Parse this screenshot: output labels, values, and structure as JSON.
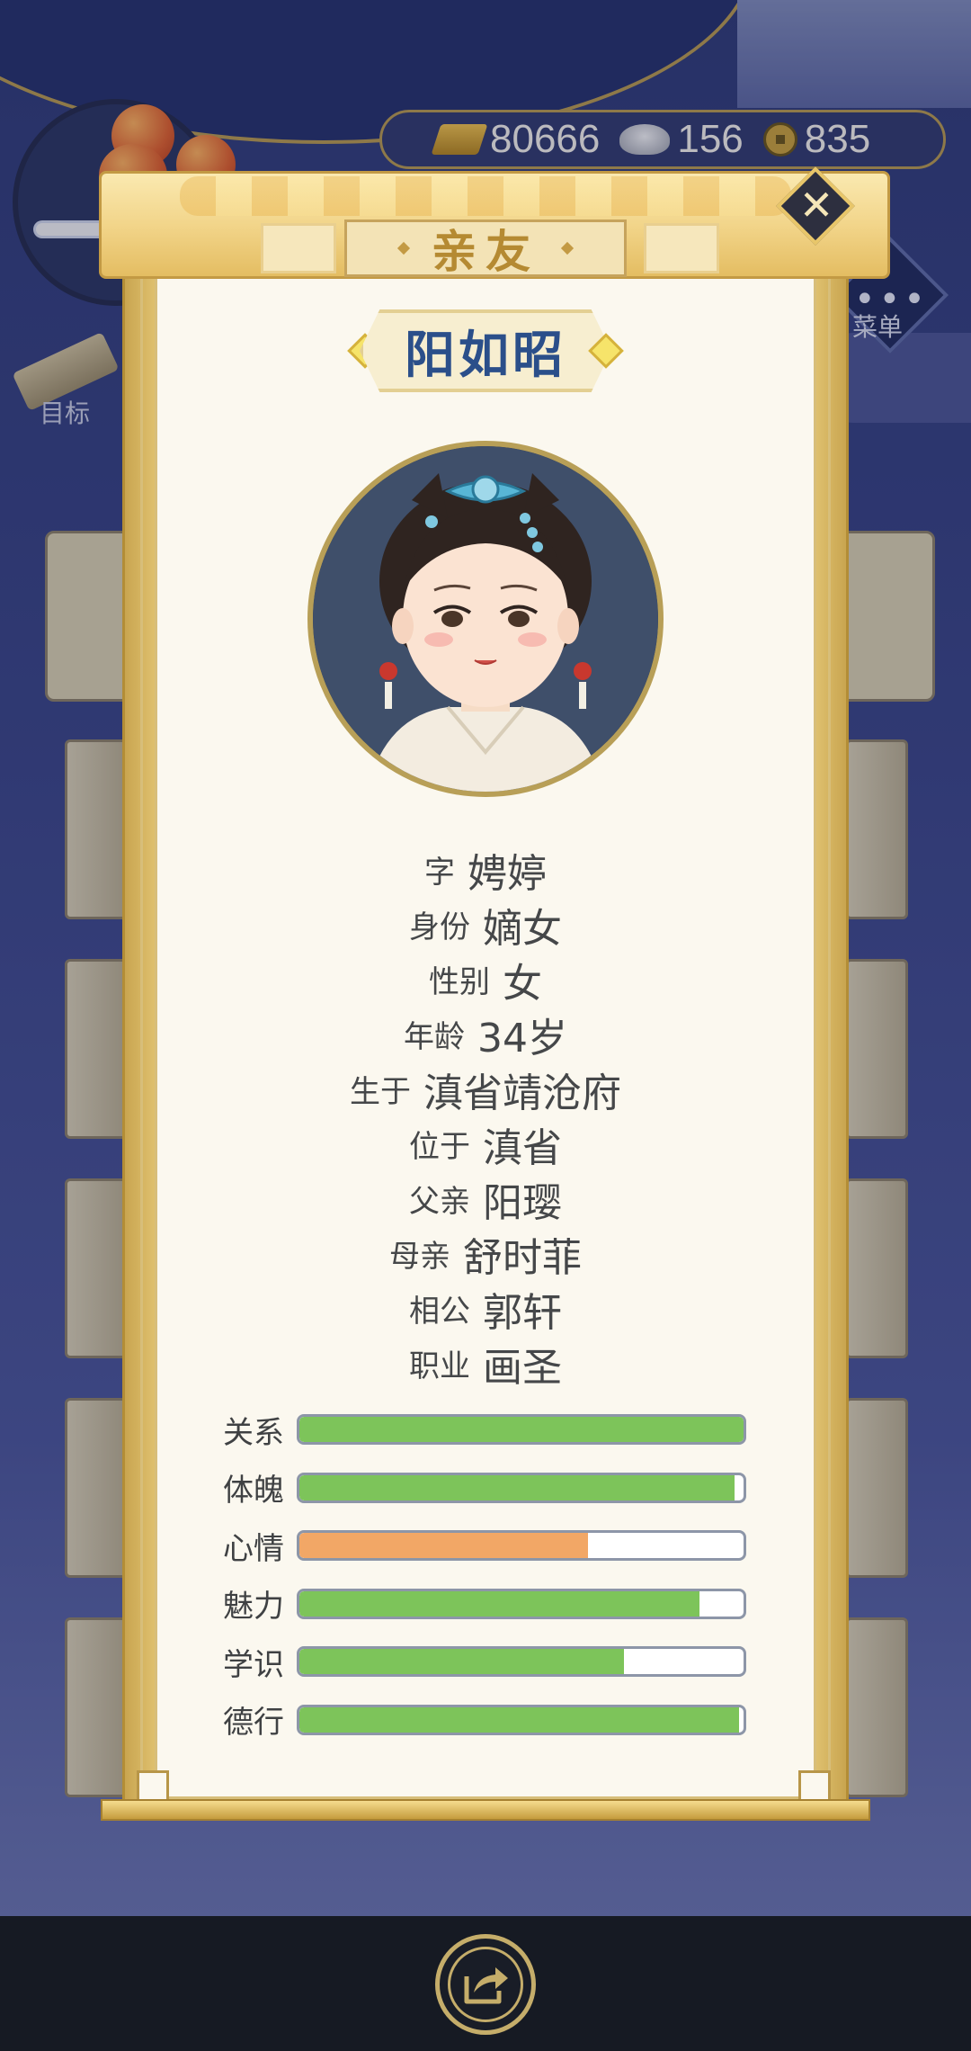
{
  "hud": {
    "gold": "80666",
    "silver": "156",
    "coins": "835",
    "menu_label": "菜单",
    "goal_label": "目标"
  },
  "dialog": {
    "title": "亲友",
    "close_icon": "close-icon",
    "character_name": "阳如昭"
  },
  "info": [
    {
      "label": "字",
      "value": "娉婷"
    },
    {
      "label": "身份",
      "value": "嫡女"
    },
    {
      "label": "性别",
      "value": "女"
    },
    {
      "label": "年龄",
      "value": "34岁"
    },
    {
      "label": "生于",
      "value": "滇省靖沧府"
    },
    {
      "label": "位于",
      "value": "滇省"
    },
    {
      "label": "父亲",
      "value": "阳璎"
    },
    {
      "label": "母亲",
      "value": "舒时菲"
    },
    {
      "label": "相公",
      "value": "郭轩"
    },
    {
      "label": "职业",
      "value": "画圣"
    }
  ],
  "stats": [
    {
      "label": "关系",
      "fraction": 1.0,
      "color": "#7dc45a"
    },
    {
      "label": "体魄",
      "fraction": 0.98,
      "color": "#7dc45a"
    },
    {
      "label": "心情",
      "fraction": 0.65,
      "color": "#f2a766"
    },
    {
      "label": "魅力",
      "fraction": 0.9,
      "color": "#7dc45a"
    },
    {
      "label": "学识",
      "fraction": 0.73,
      "color": "#7dc45a"
    },
    {
      "label": "德行",
      "fraction": 0.99,
      "color": "#7dc45a"
    }
  ],
  "bottom": {
    "share_icon": "share-icon"
  }
}
